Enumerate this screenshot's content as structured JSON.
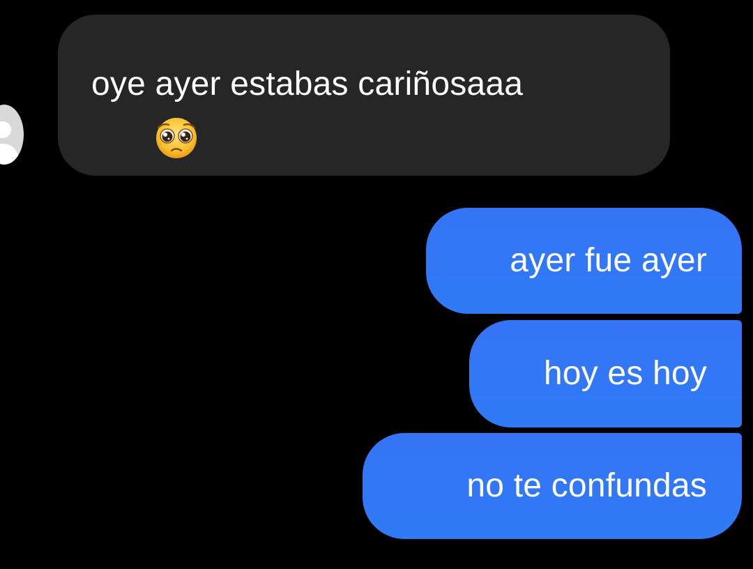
{
  "conversation": {
    "received": [
      {
        "text": "oye ayer estabas cariñosaaa",
        "emoji": "pleading-face-emoji"
      }
    ],
    "sent": [
      {
        "text": "ayer fue ayer"
      },
      {
        "text": "hoy es hoy"
      },
      {
        "text": "no te confundas"
      }
    ]
  },
  "colors": {
    "background": "#000000",
    "received_bubble": "#262626",
    "sent_bubble": "#3178F6",
    "text": "#FFFFFF"
  },
  "icons": {
    "avatar": "default-user-avatar-icon"
  }
}
